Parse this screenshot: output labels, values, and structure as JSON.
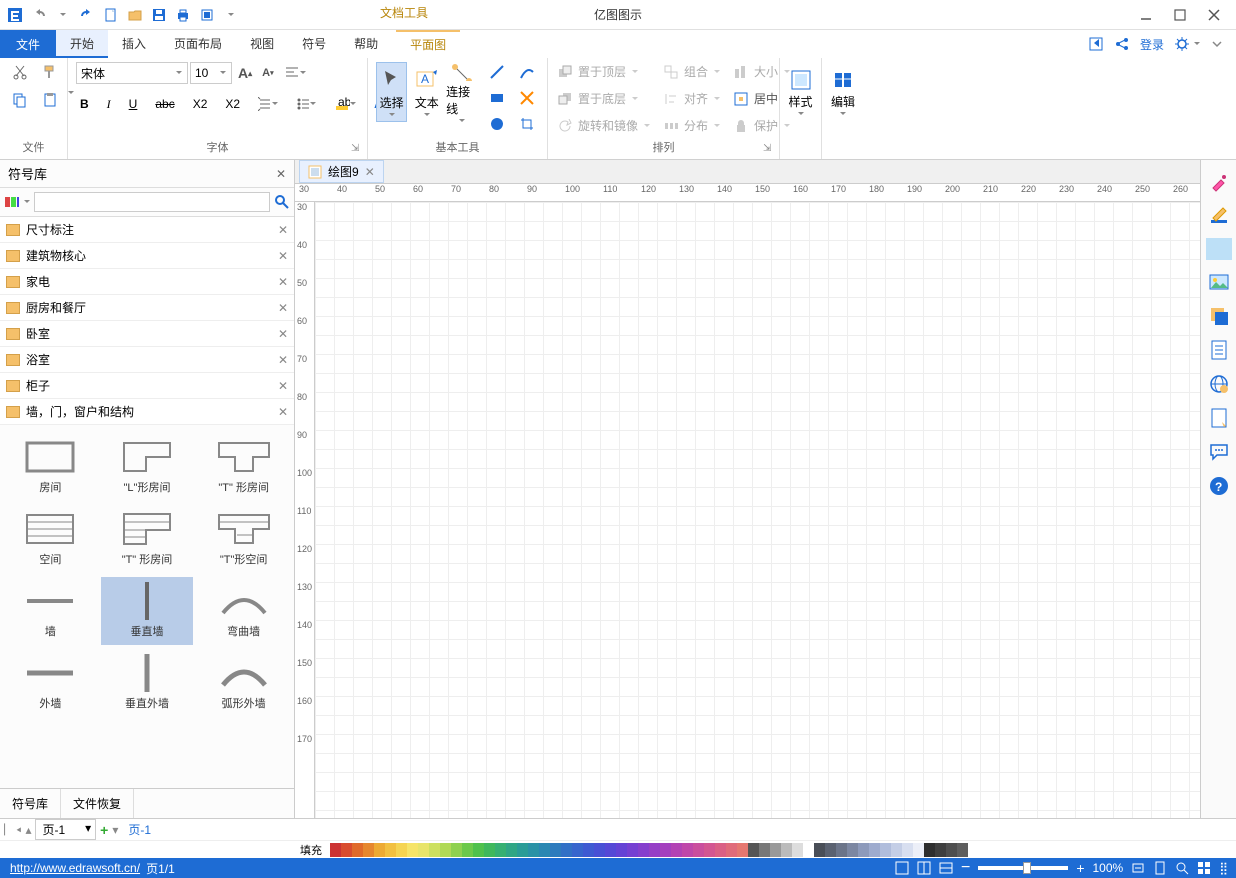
{
  "title_tools": "文档工具",
  "app_title": "亿图图示",
  "menu": {
    "file": "文件",
    "items": [
      "开始",
      "插入",
      "页面布局",
      "视图",
      "符号",
      "帮助"
    ],
    "plan": "平面图",
    "login": "登录"
  },
  "ribbon": {
    "file_group": "文件",
    "font_group": "字体",
    "font_name": "宋体",
    "font_size": "10",
    "basic_tools": "基本工具",
    "select": "选择",
    "text": "文本",
    "connector": "连接线",
    "arrange_group": "排列",
    "bring_front": "置于顶层",
    "send_back": "置于底层",
    "rotate_mirror": "旋转和镜像",
    "group": "组合",
    "align": "对齐",
    "distribute": "分布",
    "size": "大小",
    "center": "居中",
    "protect": "保护",
    "style": "样式",
    "edit": "编辑"
  },
  "panel": {
    "title": "符号库",
    "tabs": [
      "符号库",
      "文件恢复"
    ],
    "categories": [
      "尺寸标注",
      "建筑物核心",
      "家电",
      "厨房和餐厅",
      "卧室",
      "浴室",
      "柜子",
      "墙，门，窗户和结构"
    ],
    "shapes": [
      "房间",
      "\"L\"形房间",
      "\"T\" 形房间",
      "空间",
      "\"T\" 形房间",
      "\"T\"形空间",
      "墙",
      "垂直墙",
      "弯曲墙",
      "外墙",
      "垂直外墙",
      "弧形外墙"
    ]
  },
  "doc_tab": "绘图9",
  "pagebar": {
    "page_sel": "页-1",
    "page_link": "页-1",
    "fill": "填充"
  },
  "status": {
    "url": "http://www.edrawsoft.cn/",
    "page": "页1/1",
    "zoom": "100%"
  },
  "colors": [
    "#cc3333",
    "#d94c2e",
    "#e06a2a",
    "#e6872e",
    "#edaa33",
    "#f2c040",
    "#f5d452",
    "#f6e468",
    "#e8e46a",
    "#cde060",
    "#b0d956",
    "#8fd14f",
    "#6cc94a",
    "#4fc14c",
    "#3fb85c",
    "#36b072",
    "#2fa685",
    "#2a9c97",
    "#2992a6",
    "#2a87b2",
    "#2d7bbd",
    "#3170c6",
    "#3765cd",
    "#3e5ad2",
    "#4850d5",
    "#5548d6",
    "#6442d5",
    "#753fd2",
    "#853ecd",
    "#953ec6",
    "#a43fbe",
    "#b242b4",
    "#bf47a9",
    "#ca4e9d",
    "#d35691",
    "#da6085",
    "#e06b7a",
    "#e57770",
    "#555555",
    "#777777",
    "#999999",
    "#bbbbbb",
    "#dddddd",
    "#ffffff",
    "#494e57",
    "#5a6170",
    "#6b7489",
    "#7c87a2",
    "#8d9abb",
    "#9eabce",
    "#b0bddc",
    "#c4cee6",
    "#d8dff0",
    "#eceff8",
    "#2e2e2e",
    "#3e3e3e",
    "#4e4e4e",
    "#5e5e5e"
  ]
}
